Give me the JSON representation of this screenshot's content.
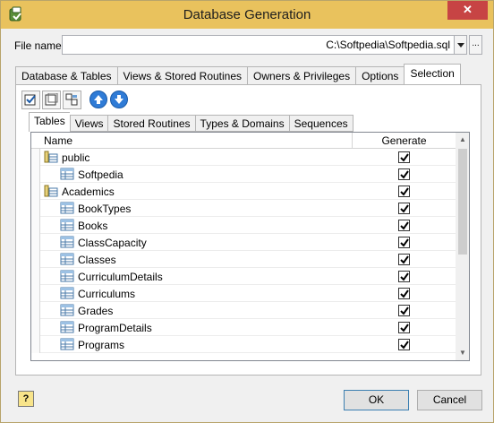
{
  "window": {
    "title": "Database Generation",
    "close_label": "✕"
  },
  "file": {
    "label": "File name",
    "value": "C:\\Softpedia\\Softpedia.sql",
    "browse_label": "..."
  },
  "tabs": [
    {
      "label": "Database & Tables"
    },
    {
      "label": "Views & Stored Routines"
    },
    {
      "label": "Owners & Privileges"
    },
    {
      "label": "Options"
    },
    {
      "label": "Selection",
      "active": true
    }
  ],
  "subtabs": [
    {
      "label": "Tables",
      "active": true
    },
    {
      "label": "Views"
    },
    {
      "label": "Stored Routines"
    },
    {
      "label": "Types & Domains"
    },
    {
      "label": "Sequences"
    }
  ],
  "grid": {
    "columns": {
      "name": "Name",
      "generate": "Generate"
    },
    "rows": [
      {
        "label": "public",
        "kind": "schema",
        "checked": true
      },
      {
        "label": "Softpedia",
        "kind": "table",
        "checked": true
      },
      {
        "label": "Academics",
        "kind": "schema",
        "checked": true
      },
      {
        "label": "BookTypes",
        "kind": "table",
        "checked": true
      },
      {
        "label": "Books",
        "kind": "table",
        "checked": true
      },
      {
        "label": "ClassCapacity",
        "kind": "table",
        "checked": true
      },
      {
        "label": "Classes",
        "kind": "table",
        "checked": true
      },
      {
        "label": "CurriculumDetails",
        "kind": "table",
        "checked": true
      },
      {
        "label": "Curriculums",
        "kind": "table",
        "checked": true
      },
      {
        "label": "Grades",
        "kind": "table",
        "checked": true
      },
      {
        "label": "ProgramDetails",
        "kind": "table",
        "checked": true
      },
      {
        "label": "Programs",
        "kind": "table",
        "checked": true
      }
    ]
  },
  "footer": {
    "help_label": "?",
    "ok_label": "OK",
    "cancel_label": "Cancel"
  },
  "colors": {
    "titlebar": "#e9c25d",
    "accent": "#2f7bd6",
    "close": "#c74444"
  }
}
